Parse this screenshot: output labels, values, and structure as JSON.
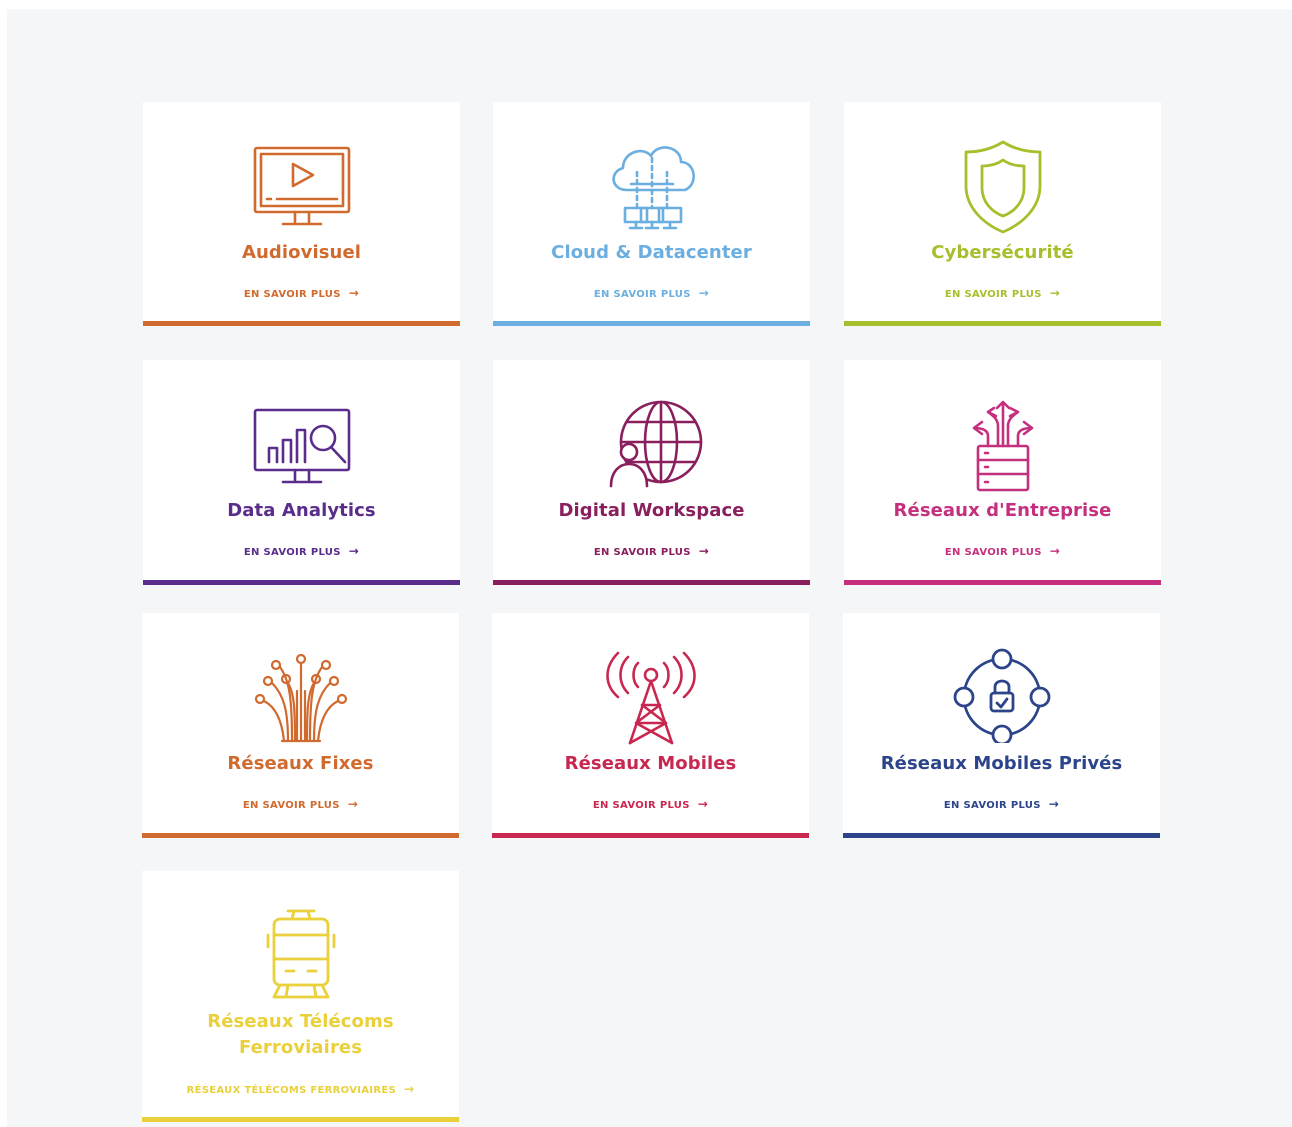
{
  "cards": [
    {
      "title": "Audiovisuel",
      "link": "EN SAVOIR PLUS",
      "color": "#d06a2e",
      "icon": "monitor-play-icon"
    },
    {
      "title": "Cloud & Datacenter",
      "link": "EN SAVOIR PLUS",
      "color": "#6baee0",
      "icon": "cloud-network-icon"
    },
    {
      "title": "Cybersécurité",
      "link": "EN SAVOIR PLUS",
      "color": "#a6bf2c",
      "icon": "shield-icon"
    },
    {
      "title": "Data Analytics",
      "link": "EN SAVOIR PLUS",
      "color": "#5a2d8c",
      "icon": "analytics-monitor-icon"
    },
    {
      "title": "Digital Workspace",
      "link": "EN SAVOIR PLUS",
      "color": "#8a1f5e",
      "icon": "globe-user-icon"
    },
    {
      "title": "Réseaux d'Entreprise",
      "link": "EN SAVOIR PLUS",
      "color": "#c5307e",
      "icon": "server-arrows-icon"
    },
    {
      "title": "Réseaux Fixes",
      "link": "EN SAVOIR PLUS",
      "color": "#d06a2e",
      "icon": "fiber-optic-icon"
    },
    {
      "title": "Réseaux Mobiles",
      "link": "EN SAVOIR PLUS",
      "color": "#c8284f",
      "icon": "antenna-tower-icon"
    },
    {
      "title": "Réseaux Mobiles Privés",
      "link": "EN SAVOIR PLUS",
      "color": "#2c4489",
      "icon": "network-lock-icon"
    },
    {
      "title": "Réseaux Télécoms Ferroviaires",
      "link": "RÉSEAUX TÉLÉCOMS FERROVIAIRES",
      "color": "#ead03b",
      "icon": "tram-icon"
    }
  ],
  "arrow": "→"
}
